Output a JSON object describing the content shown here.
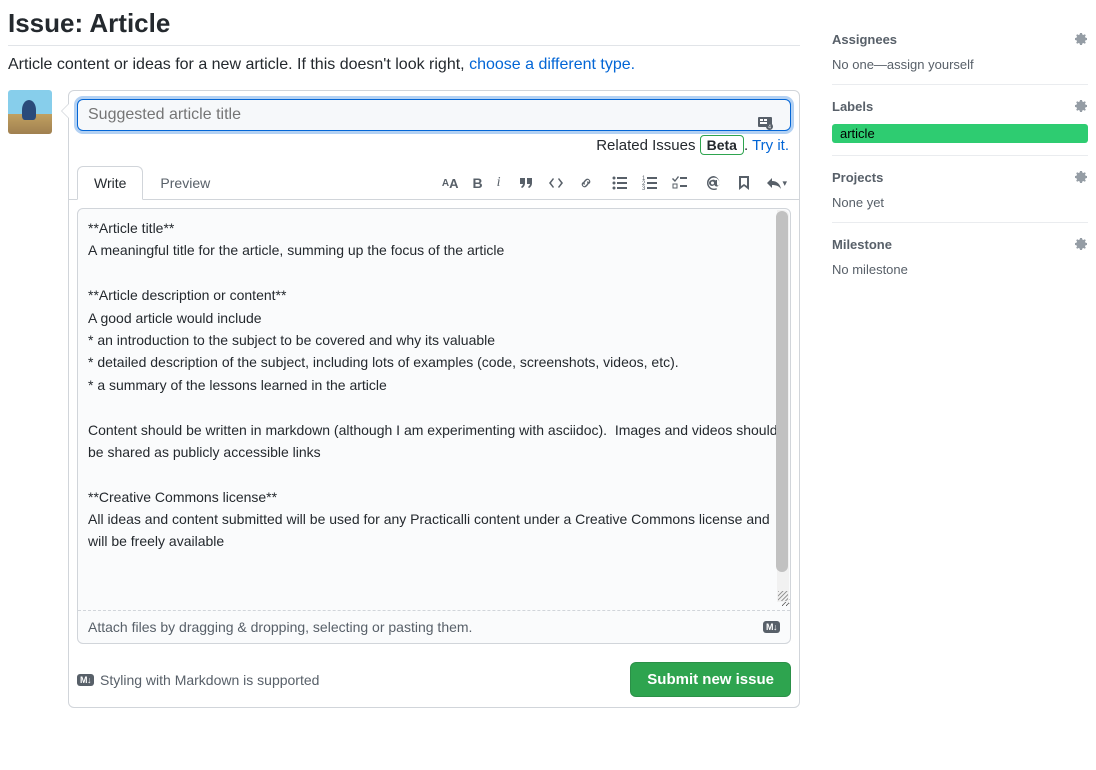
{
  "header": {
    "title": "Issue: Article",
    "description": "Article content or ideas for a new article. If this doesn't look right, ",
    "choose_link": "choose a different type."
  },
  "form": {
    "title_placeholder": "Suggested article title",
    "related_label": "Related Issues",
    "beta": "Beta",
    "try_it": "Try it.",
    "tabs": {
      "write": "Write",
      "preview": "Preview"
    },
    "body": "**Article title**\nA meaningful title for the article, summing up the focus of the article\n\n**Article description or content**\nA good article would include\n* an introduction to the subject to be covered and why its valuable\n* detailed description of the subject, including lots of examples (code, screenshots, videos, etc).\n* a summary of the lessons learned in the article\n\nContent should be written in markdown (although I am experimenting with asciidoc).  Images and videos should be shared as publicly accessible links\n\n**Creative Commons license**\nAll ideas and content submitted will be used for any Practicalli content under a Creative Commons license and will be freely available",
    "attach_hint": "Attach files by dragging & dropping, selecting or pasting them.",
    "md_hint": "Styling with Markdown is supported",
    "submit": "Submit new issue",
    "md_badge": "M↓"
  },
  "sidebar": {
    "assignees": {
      "title": "Assignees",
      "body": "No one—assign yourself"
    },
    "labels": {
      "title": "Labels",
      "chip": "article"
    },
    "projects": {
      "title": "Projects",
      "body": "None yet"
    },
    "milestone": {
      "title": "Milestone",
      "body": "No milestone"
    }
  }
}
